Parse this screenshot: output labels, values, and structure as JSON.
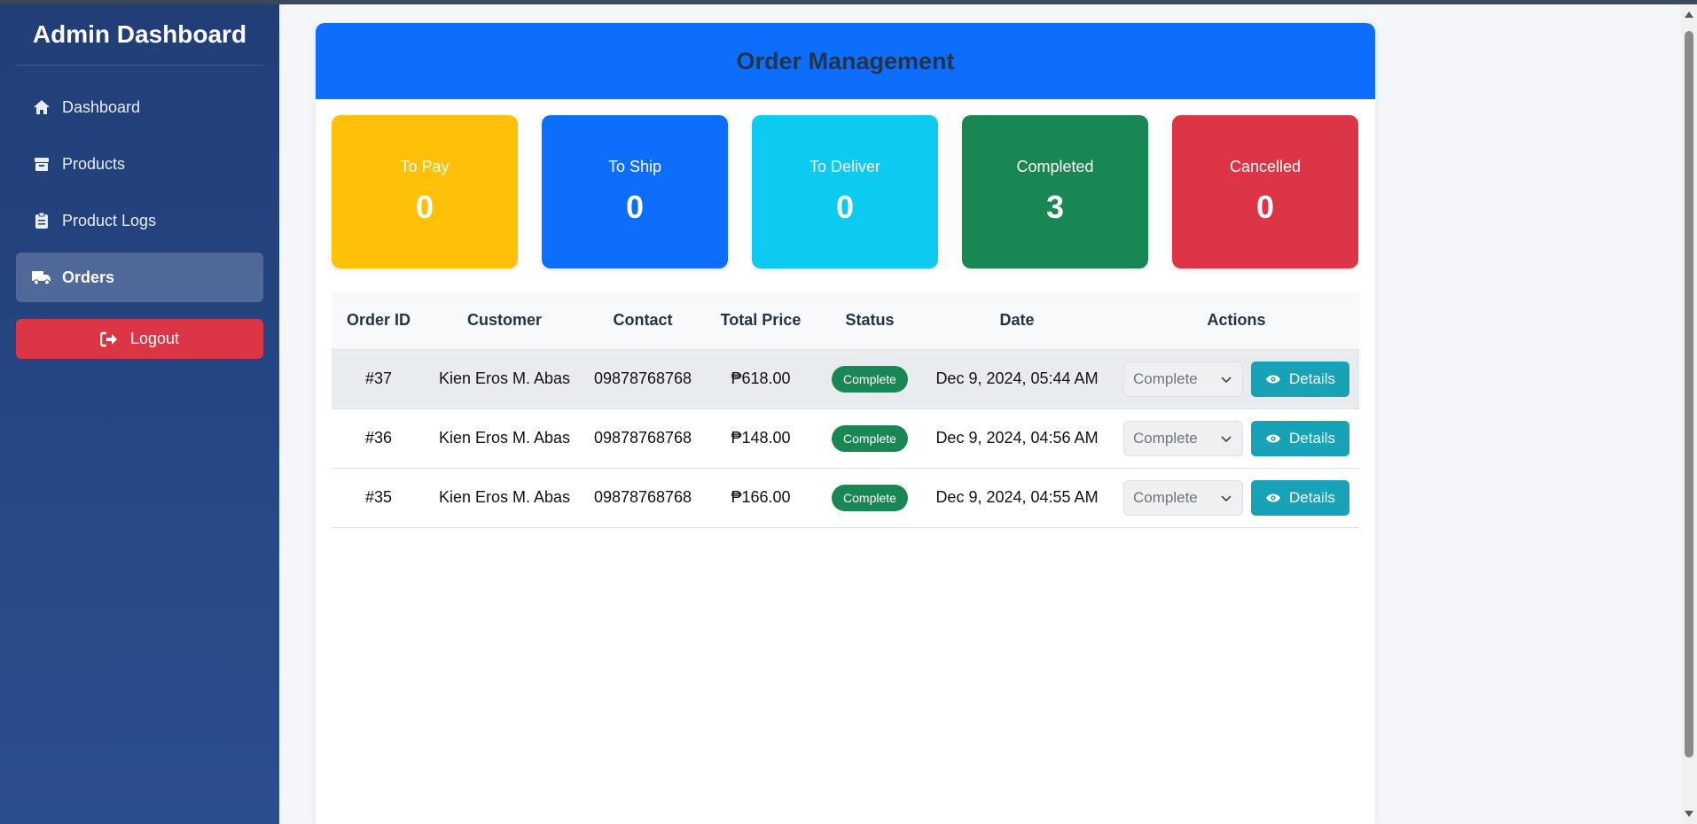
{
  "sidebar": {
    "title": "Admin Dashboard",
    "items": [
      {
        "label": "Dashboard",
        "icon": "home-icon"
      },
      {
        "label": "Products",
        "icon": "box-icon"
      },
      {
        "label": "Product Logs",
        "icon": "clipboard-icon"
      },
      {
        "label": "Orders",
        "icon": "truck-icon",
        "active": true
      }
    ],
    "logout_label": "Logout"
  },
  "main": {
    "title": "Order Management",
    "cards": [
      {
        "label": "To Pay",
        "count": "0",
        "color": "#ffc107"
      },
      {
        "label": "To Ship",
        "count": "0",
        "color": "#0d6efd"
      },
      {
        "label": "To Deliver",
        "count": "0",
        "color": "#0dcaf0"
      },
      {
        "label": "Completed",
        "count": "3",
        "color": "#198754"
      },
      {
        "label": "Cancelled",
        "count": "0",
        "color": "#dc3545"
      }
    ],
    "table": {
      "headers": [
        "Order ID",
        "Customer",
        "Contact",
        "Total Price",
        "Status",
        "Date",
        "Actions"
      ],
      "rows": [
        {
          "id": "#37",
          "customer": "Kien Eros M. Abas",
          "contact": "09878768768",
          "total": "₱618.00",
          "status": "Complete",
          "date": "Dec 9, 2024, 05:44 AM",
          "select": "Complete",
          "details": "Details"
        },
        {
          "id": "#36",
          "customer": "Kien Eros M. Abas",
          "contact": "09878768768",
          "total": "₱148.00",
          "status": "Complete",
          "date": "Dec 9, 2024, 04:56 AM",
          "select": "Complete",
          "details": "Details"
        },
        {
          "id": "#35",
          "customer": "Kien Eros M. Abas",
          "contact": "09878768768",
          "total": "₱166.00",
          "status": "Complete",
          "date": "Dec 9, 2024, 04:55 AM",
          "select": "Complete",
          "details": "Details"
        }
      ]
    }
  }
}
